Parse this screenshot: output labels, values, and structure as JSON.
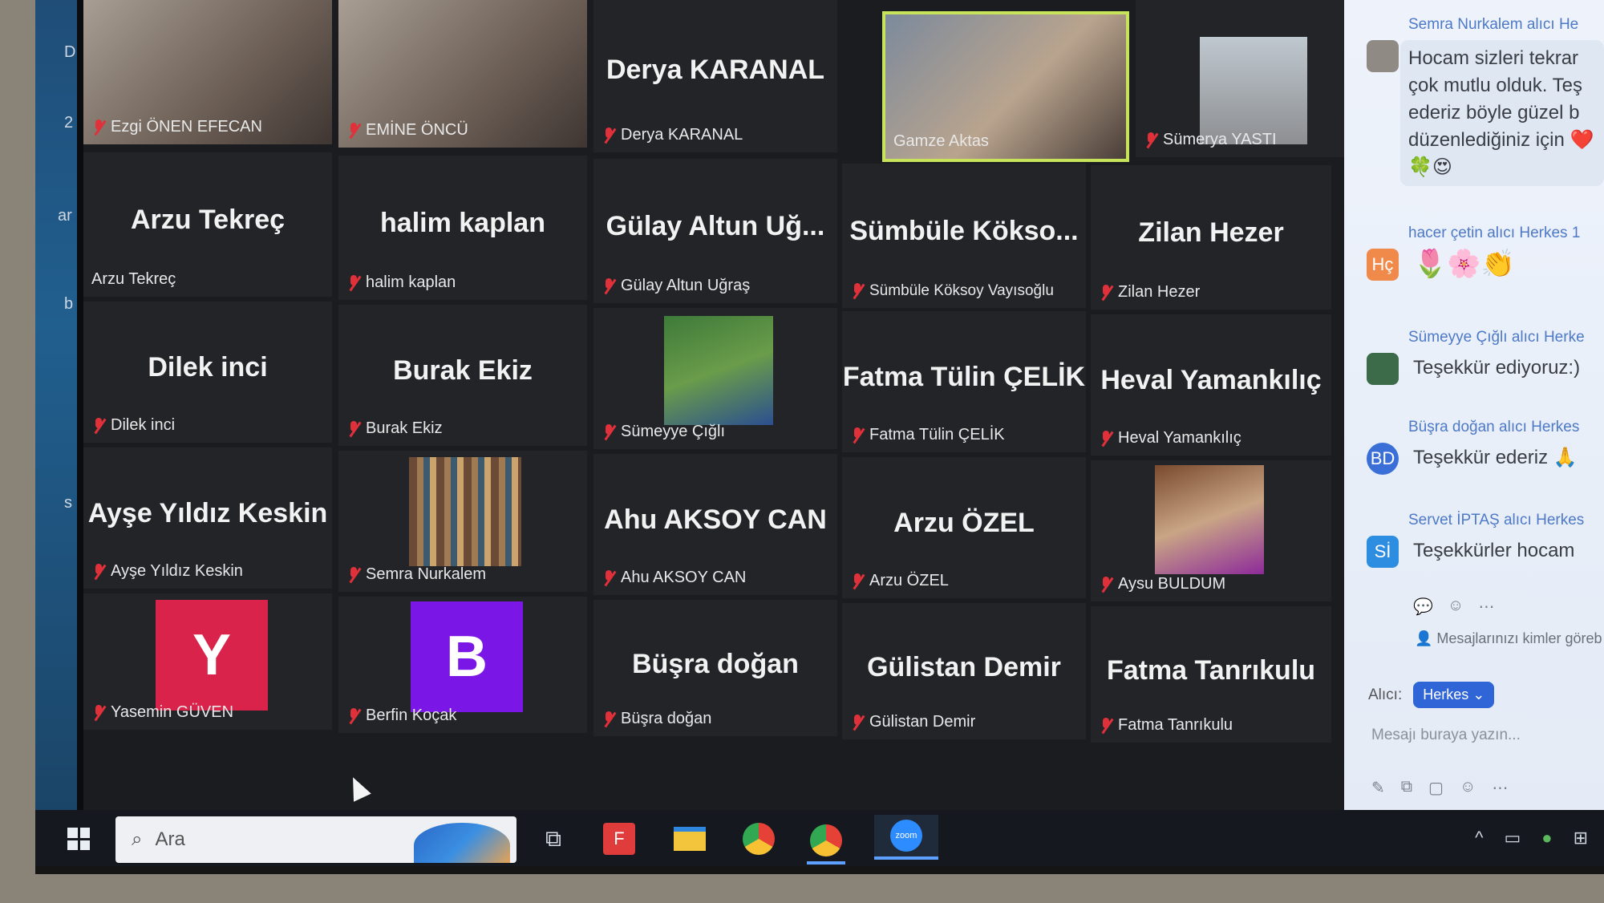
{
  "app": {
    "name": "Zoom Meeting"
  },
  "left_edge_letters": [
    "D",
    "2",
    "ar",
    "b",
    "s"
  ],
  "participants": [
    {
      "id": "ezgi",
      "name": "Ezgi ÖNEN EFECAN",
      "display": "",
      "type": "video"
    },
    {
      "id": "emine",
      "name": "EMİNE ÖNCÜ",
      "display": "",
      "type": "video"
    },
    {
      "id": "derya",
      "name": "Derya KARANAL",
      "display": "Derya KARANAL",
      "type": "name"
    },
    {
      "id": "gamze",
      "name": "Gamze Aktas",
      "display": "",
      "type": "video",
      "speaking": true
    },
    {
      "id": "sumerya",
      "name": "Sümerya YASTI",
      "display": "",
      "type": "photo"
    },
    {
      "id": "arzu_t",
      "name": "Arzu Tekreç",
      "display": "Arzu Tekreç",
      "type": "name"
    },
    {
      "id": "halim",
      "name": "halim kaplan",
      "display": "halim kaplan",
      "type": "name"
    },
    {
      "id": "gulay",
      "name": "Gülay Altun Uğraş",
      "display": "Gülay Altun Uğ...",
      "type": "name"
    },
    {
      "id": "sumbule",
      "name": "Sümbüle Köksoy Vayısoğlu",
      "display": "Sümbüle Kökso...",
      "type": "name"
    },
    {
      "id": "zilan",
      "name": "Zilan Hezer",
      "display": "Zilan Hezer",
      "type": "name"
    },
    {
      "id": "dilek",
      "name": "Dilek inci",
      "display": "Dilek inci",
      "type": "name"
    },
    {
      "id": "burak",
      "name": "Burak Ekiz",
      "display": "Burak Ekiz",
      "type": "name"
    },
    {
      "id": "sumeyye",
      "name": "Sümeyye Çığlı",
      "display": "",
      "type": "photo"
    },
    {
      "id": "fatma_c",
      "name": "Fatma Tülin ÇELİK",
      "display": "Fatma Tülin ÇELİK",
      "type": "name"
    },
    {
      "id": "heval",
      "name": "Heval Yamankılıç",
      "display": "Heval Yamankılıç",
      "type": "name"
    },
    {
      "id": "ayse",
      "name": "Ayşe Yıldız Keskin",
      "display": "Ayşe Yıldız Keskin",
      "type": "name"
    },
    {
      "id": "semra",
      "name": "Semra Nurkalem",
      "display": "",
      "type": "photo"
    },
    {
      "id": "ahu",
      "name": "Ahu AKSOY CAN",
      "display": "Ahu AKSOY CAN",
      "type": "name"
    },
    {
      "id": "arzu_o",
      "name": "Arzu ÖZEL",
      "display": "Arzu ÖZEL",
      "type": "name"
    },
    {
      "id": "aysu",
      "name": "Aysu BULDUM",
      "display": "",
      "type": "photo"
    },
    {
      "id": "yasemin",
      "name": "Yasemin GÜVEN",
      "display": "",
      "type": "avatar",
      "letter": "Y",
      "color": "#d9234a"
    },
    {
      "id": "berfin",
      "name": "Berfin Koçak",
      "display": "",
      "type": "avatar",
      "letter": "B",
      "color": "#7a16e6"
    },
    {
      "id": "busra",
      "name": "Büşra doğan",
      "display": "Büşra doğan",
      "type": "name"
    },
    {
      "id": "gulistan",
      "name": "Gülistan Demir",
      "display": "Gülistan Demir",
      "type": "name"
    },
    {
      "id": "fatma_t",
      "name": "Fatma Tanrıkulu",
      "display": "Fatma Tanrıkulu",
      "type": "name"
    }
  ],
  "chat": {
    "messages": [
      {
        "sender": "Semra Nurkalem",
        "to": "alıcı He",
        "avatar_text": "",
        "avatar_color": "#8f8a84",
        "lines": [
          "Hocam sizleri tekrar",
          "çok mutlu olduk. Teş",
          "ederiz böyle güzel b",
          "düzenlediğiniz için ❤️",
          "🍀😍"
        ]
      },
      {
        "sender": "hacer çetin",
        "to": "alıcı Herkes 1",
        "avatar_text": "Hç",
        "avatar_color": "#f08a4b",
        "lines": [
          "🌷🌸👏"
        ]
      },
      {
        "sender": "Sümeyye Çığlı",
        "to": "alıcı Herke",
        "avatar_text": "",
        "avatar_color": "#3c6b4a",
        "lines": [
          "Teşekkür ediyoruz:)"
        ]
      },
      {
        "sender": "Büşra doğan",
        "to": "alıcı Herkes",
        "avatar_text": "BD",
        "avatar_color": "#3a6fd8",
        "lines": [
          "Teşekkür ederiz 🙏"
        ]
      },
      {
        "sender": "Servet İPTAŞ",
        "to": "alıcı Herkes",
        "avatar_text": "Sİ",
        "avatar_color": "#2d8de0",
        "lines": [
          "Teşekkürler hocam"
        ]
      }
    ],
    "reaction_icons": [
      "💬",
      "☺",
      "⋯"
    ],
    "privacy_note": "Mesajlarınızı kimler göreb",
    "recipient_label": "Alıcı:",
    "recipient_value": "Herkes ⌄",
    "input_placeholder": "Mesajı buraya yazın...",
    "tools": [
      "✎",
      "⧉",
      "▢",
      "☺",
      "⋯"
    ]
  },
  "taskbar": {
    "search_placeholder": "Ara",
    "icons": [
      "task-view",
      "app-red",
      "file-explorer",
      "chrome",
      "chrome-profile",
      "zoom"
    ],
    "zoom_label": "zoom",
    "tray": [
      "^",
      "▭",
      "●",
      "⊞"
    ]
  }
}
